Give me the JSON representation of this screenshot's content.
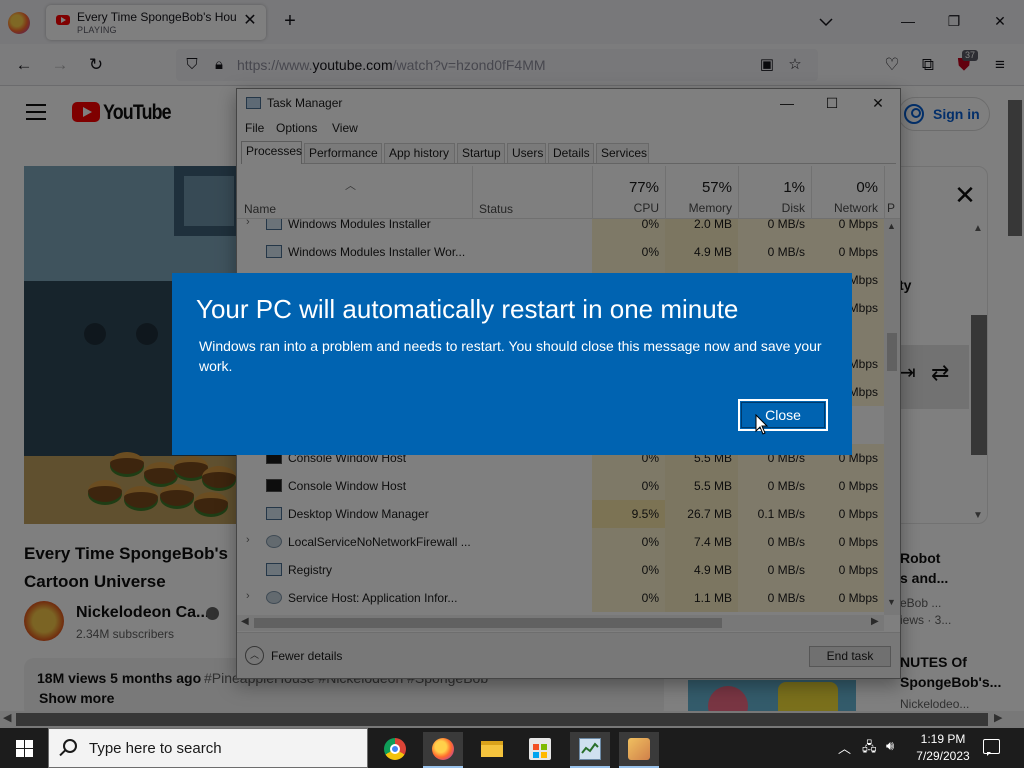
{
  "browser": {
    "tab": {
      "title": "Every Time SpongeBob's House...",
      "status": "PLAYING"
    },
    "url": {
      "prefix": "https://www.",
      "domain": "youtube.com",
      "path": "/watch?v=hzond0fF4MM"
    },
    "extension_badge": "37",
    "icons": {
      "back": "back-arrow-icon",
      "forward": "forward-arrow-icon",
      "reload": "reload-icon",
      "tracking": "shield-icon",
      "lock": "lock-icon",
      "bookmark": "star-icon",
      "pocket": "pocket-icon",
      "extensions": "puzzle-icon",
      "menu": "hamburger-icon"
    }
  },
  "youtube": {
    "logo_text": "YouTube",
    "sign_in": "Sign in",
    "video_title": "Every Time SpongeBob's Cartoon Universe",
    "channel_name": "Nickelodeon Ca...",
    "subscribers": "2.34M subscribers",
    "views_age": "18M views  5 months ago",
    "hashtags": "#PineappleHouse #Nickelodeon #SpongeBob",
    "show_more": "Show more",
    "panel_fragment": "ty",
    "recommendations": [
      {
        "title_line1": "Robot",
        "title_line2": "s and...",
        "meta_line1": "eBob ...",
        "meta_line2": "iews · 3..."
      },
      {
        "title_line1": "NUTES Of",
        "title_line2": "SpongeBob's...",
        "meta_line1": "Nickelodeo..."
      }
    ]
  },
  "task_manager": {
    "title": "Task Manager",
    "menu": [
      "File",
      "Options",
      "View"
    ],
    "tabs": [
      "Processes",
      "Performance",
      "App history",
      "Startup",
      "Users",
      "Details",
      "Services"
    ],
    "active_tab": "Processes",
    "columns": {
      "name": "Name",
      "status": "Status",
      "cpu": {
        "label": "CPU",
        "total": "77%"
      },
      "memory": {
        "label": "Memory",
        "total": "57%"
      },
      "disk": {
        "label": "Disk",
        "total": "1%"
      },
      "network": {
        "label": "Network",
        "total": "0%"
      },
      "power": "P"
    },
    "processes_top": [
      {
        "name": "Windows Modules Installer",
        "cpu": "0%",
        "memory": "2.0 MB",
        "disk": "0 MB/s",
        "network": "0 Mbps",
        "expandable": true,
        "icon": "window-icon"
      },
      {
        "name": "Windows Modules Installer Wor...",
        "cpu": "0%",
        "memory": "4.9 MB",
        "disk": "0 MB/s",
        "network": "0 Mbps",
        "expandable": false,
        "icon": "window-icon"
      }
    ],
    "hidden_network": [
      "0 Mbps",
      "0 Mbps",
      "",
      "0 Mbps",
      "0 Mbps"
    ],
    "processes_bottom": [
      {
        "name": "Console Window Host",
        "cpu": "0%",
        "memory": "5.5 MB",
        "disk": "0 MB/s",
        "network": "0 Mbps",
        "expandable": false,
        "icon": "console-icon"
      },
      {
        "name": "Console Window Host",
        "cpu": "0%",
        "memory": "5.5 MB",
        "disk": "0 MB/s",
        "network": "0 Mbps",
        "expandable": false,
        "icon": "console-icon"
      },
      {
        "name": "Desktop Window Manager",
        "cpu": "9.5%",
        "memory": "26.7 MB",
        "disk": "0.1 MB/s",
        "network": "0 Mbps",
        "expandable": false,
        "icon": "window-icon"
      },
      {
        "name": "LocalServiceNoNetworkFirewall ...",
        "cpu": "0%",
        "memory": "7.4 MB",
        "disk": "0 MB/s",
        "network": "0 Mbps",
        "expandable": true,
        "icon": "gear-icon"
      },
      {
        "name": "Registry",
        "cpu": "0%",
        "memory": "4.9 MB",
        "disk": "0 MB/s",
        "network": "0 Mbps",
        "expandable": false,
        "icon": "window-icon"
      },
      {
        "name": "Service Host: Application Infor...",
        "cpu": "0%",
        "memory": "1.1 MB",
        "disk": "0 MB/s",
        "network": "0 Mbps",
        "expandable": true,
        "icon": "gear-icon"
      }
    ],
    "fewer_details": "Fewer details",
    "end_task": "End task",
    "colors": {
      "cpu_cell": "#fcf3cf",
      "cpu_cell_hot": "#f9e6a8",
      "memory_cell": "#f9ecc2"
    }
  },
  "dialog": {
    "title": "Your PC will automatically restart in one minute",
    "message": "Windows ran into a problem and needs to restart. You should close this message now and save your work.",
    "close_button": "Close",
    "color": "#0063b1"
  },
  "taskbar": {
    "search_placeholder": "Type here to search",
    "apps": [
      "chrome-icon",
      "firefox-icon",
      "file-explorer-icon",
      "store-icon",
      "task-manager-icon",
      "paint-icon"
    ],
    "time": "1:19 PM",
    "date": "7/29/2023"
  }
}
